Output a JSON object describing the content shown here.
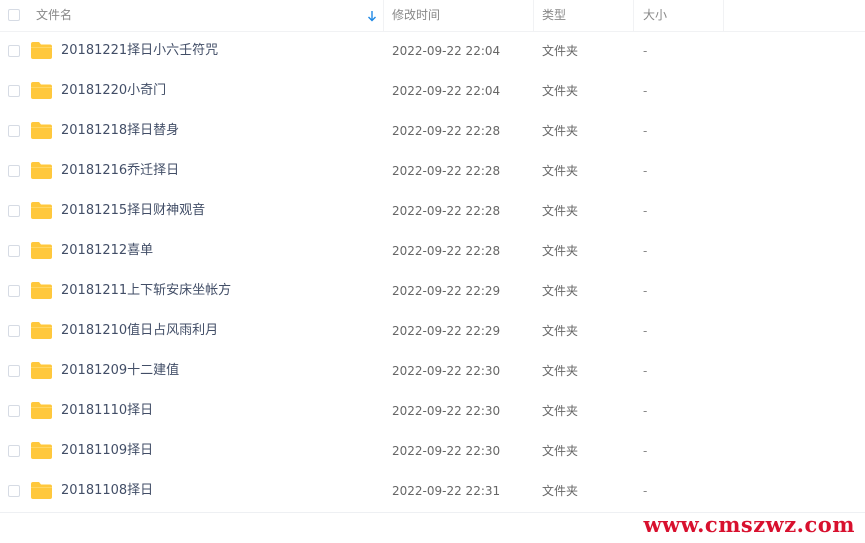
{
  "header": {
    "name_label": "文件名",
    "time_label": "修改时间",
    "type_label": "类型",
    "size_label": "大小",
    "sort_icon": "arrow-down-icon"
  },
  "colors": {
    "folder": "#ffc83d",
    "watermark": "#d8102e",
    "sort_arrow": "#1e88e5"
  },
  "rows": [
    {
      "name": "20181221择日小六壬符咒",
      "time": "2022-09-22 22:04",
      "type": "文件夹",
      "size": "-"
    },
    {
      "name": "20181220小奇门",
      "time": "2022-09-22 22:04",
      "type": "文件夹",
      "size": "-"
    },
    {
      "name": "20181218择日替身",
      "time": "2022-09-22 22:28",
      "type": "文件夹",
      "size": "-"
    },
    {
      "name": "20181216乔迁择日",
      "time": "2022-09-22 22:28",
      "type": "文件夹",
      "size": "-"
    },
    {
      "name": "20181215择日财神观音",
      "time": "2022-09-22 22:28",
      "type": "文件夹",
      "size": "-"
    },
    {
      "name": "20181212喜单",
      "time": "2022-09-22 22:28",
      "type": "文件夹",
      "size": "-"
    },
    {
      "name": "20181211上下斩安床坐帐方",
      "time": "2022-09-22 22:29",
      "type": "文件夹",
      "size": "-"
    },
    {
      "name": "20181210值日占风雨利月",
      "time": "2022-09-22 22:29",
      "type": "文件夹",
      "size": "-"
    },
    {
      "name": "20181209十二建值",
      "time": "2022-09-22 22:30",
      "type": "文件夹",
      "size": "-"
    },
    {
      "name": "20181110择日",
      "time": "2022-09-22 22:30",
      "type": "文件夹",
      "size": "-"
    },
    {
      "name": "20181109择日",
      "time": "2022-09-22 22:30",
      "type": "文件夹",
      "size": "-"
    },
    {
      "name": "20181108择日",
      "time": "2022-09-22 22:31",
      "type": "文件夹",
      "size": "-"
    }
  ],
  "watermark": {
    "text": "www.cmszwz.com"
  }
}
